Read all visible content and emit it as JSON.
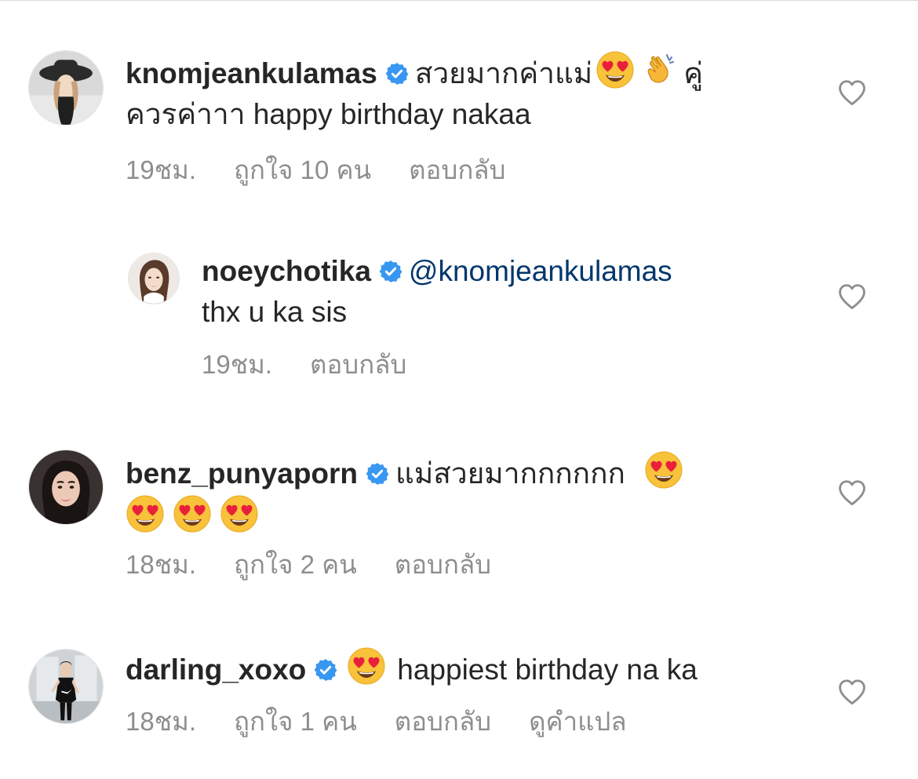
{
  "comments": [
    {
      "username": "knomjeankulamas",
      "verified": true,
      "text_1": "สวยมากค่าแม่",
      "emoji_1": "heart-eyes",
      "emoji_2": "clapping-hands",
      "text_2": "คู่",
      "text_3": "ควรค่าาา happy birthday nakaa",
      "time": "19ชม.",
      "likes": "ถูกใจ 10 คน",
      "reply": "ตอบกลับ"
    },
    {
      "username": "noeychotika",
      "verified": true,
      "mention": "@knomjeankulamas",
      "text": "thx u ka sis",
      "time": "19ชม.",
      "reply": "ตอบกลับ"
    },
    {
      "username": "benz_punyaporn",
      "verified": true,
      "text": "แม่สวยมากกกกกก",
      "emoji": "heart-eyes",
      "emoji_count_line1": 1,
      "emoji_count_line2": 3,
      "time": "18ชม.",
      "likes": "ถูกใจ 2 คน",
      "reply": "ตอบกลับ"
    },
    {
      "username": "darling_xoxo",
      "verified": true,
      "emoji": "heart-eyes",
      "text": "happiest birthday na ka",
      "time": "18ชม.",
      "likes": "ถูกใจ 1 คน",
      "reply": "ตอบกลับ",
      "translate": "ดูคำแปล"
    }
  ],
  "colors": {
    "text": "#262626",
    "meta": "#8e8e8e",
    "mention": "#00376b",
    "verified_badge": "#3897f0",
    "heart_outline": "#8e8e8e"
  },
  "icons": {
    "like": "heart-outline-icon",
    "verified": "verified-badge-icon"
  }
}
